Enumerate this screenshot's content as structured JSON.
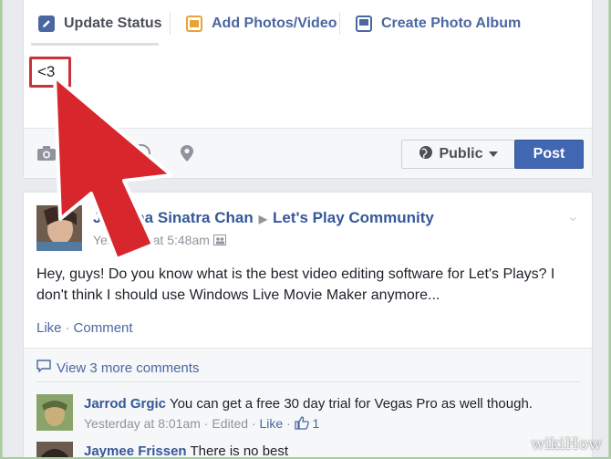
{
  "composer": {
    "tabs": [
      {
        "label": "Update Status",
        "icon": "pencil-icon"
      },
      {
        "label": "Add Photos/Video",
        "icon": "photo-icon"
      },
      {
        "label": "Create Photo Album",
        "icon": "album-icon"
      }
    ],
    "status_value": "<3",
    "footer": {
      "privacy_label": "Public",
      "post_label": "Post"
    }
  },
  "story": {
    "author": "Jordana Sinatra Chan",
    "group": "Let's Play Community",
    "time": "Yesterday at 5:48am",
    "text": "Hey, guys! Do you know what is the best video editing software for Let's Plays? I don't think I should use Windows Live Movie Maker anymore...",
    "like_label": "Like",
    "comment_label": "Comment",
    "view_more": "View 3 more comments",
    "comments": [
      {
        "name": "Jarrod Grgic",
        "text": "You can get a free 30 day trial for Vegas Pro as well though.",
        "time": "Yesterday at 8:01am",
        "edited": "Edited",
        "like": "Like",
        "likes": "1"
      },
      {
        "name": "Jaymee Frissen",
        "text": "There is no best"
      }
    ]
  },
  "watermark": "wikiHow",
  "colors": {
    "accent": "#4267b2",
    "link": "#365899",
    "highlight_border": "#c8323a",
    "arrow_red": "#d8262d"
  }
}
